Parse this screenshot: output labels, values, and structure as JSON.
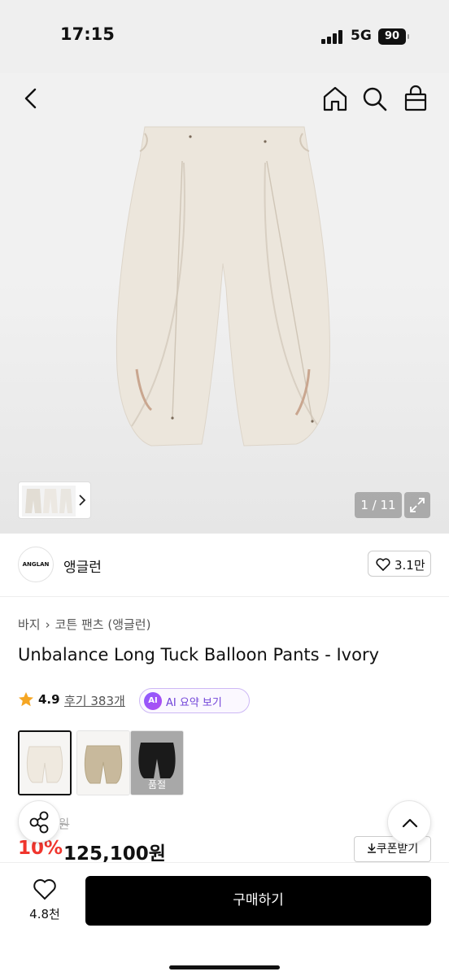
{
  "status": {
    "time": "17:15",
    "network": "5G",
    "battery": "90"
  },
  "gallery": {
    "counter": "1 / 11"
  },
  "brand": {
    "logo_text": "ANGLAN",
    "name": "앵글런",
    "likes": "3.1만"
  },
  "breadcrumb": {
    "category": "바지",
    "subcategory": "코튼 팬츠 (앵글런)"
  },
  "product": {
    "title": "Unbalance Long Tuck Balloon Pants - Ivory",
    "rating": "4.9",
    "reviews": "후기 383개",
    "ai_badge": "AI",
    "ai_summary": "AI 요약 보기"
  },
  "variants": [
    {
      "color": "#efe9df",
      "soldout": ""
    },
    {
      "color": "#c8b99c",
      "soldout": ""
    },
    {
      "color": "#1a1a1a",
      "soldout": "품절"
    }
  ],
  "price": {
    "original": "0원",
    "discount": "10%",
    "sale": "125,100원",
    "coupon": "쿠폰받기"
  },
  "bottom_bar": {
    "wish_count": "4.8천",
    "buy_label": "구매하기"
  },
  "icons": {
    "back": "chevron-left-icon",
    "home": "home-icon",
    "search": "search-icon",
    "bag": "shopping-bag-icon",
    "share": "share-icon",
    "top": "chevron-up-icon",
    "heart": "heart-icon",
    "star": "star-icon",
    "download": "download-icon",
    "expand": "expand-icon"
  },
  "colors": {
    "discount": "#f0352d",
    "buy_button": "#000000",
    "star": "#f5a623",
    "ai_accent": "#7042d8"
  }
}
